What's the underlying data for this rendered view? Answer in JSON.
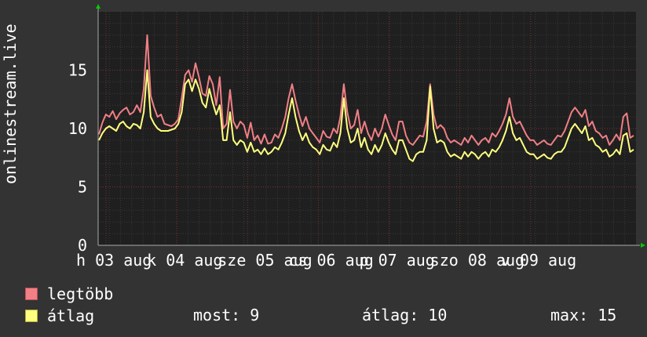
{
  "chart_data": {
    "type": "line",
    "ylabel": "onlinestream.live",
    "ylim": [
      0,
      20
    ],
    "yticks": [
      0,
      5,
      10,
      15
    ],
    "xtick_labels": [
      "h 03 aug",
      "k 04 aug",
      "sze 05 aug",
      "cs 06 aug",
      "p 07 aug",
      "szo 08 aug",
      "v 09 aug"
    ],
    "grid": true,
    "legend_position": "bottom-left",
    "series": [
      {
        "name": "legtöbb",
        "color": "#f07f86",
        "values": [
          9.5,
          10.5,
          11.2,
          11.0,
          11.5,
          10.8,
          11.3,
          11.6,
          11.8,
          11.2,
          11.4,
          12.0,
          11.4,
          13.4,
          18.0,
          12.8,
          11.8,
          11.0,
          11.2,
          10.4,
          10.3,
          10.2,
          10.4,
          10.8,
          12.6,
          14.6,
          15.0,
          14.0,
          15.6,
          14.4,
          13.0,
          12.8,
          14.5,
          13.8,
          12.0,
          14.4,
          10.0,
          10.4,
          13.3,
          10.6,
          10.0,
          10.6,
          10.3,
          9.2,
          10.5,
          9.0,
          9.4,
          8.7,
          9.5,
          8.7,
          8.8,
          9.5,
          9.2,
          10.0,
          11.0,
          12.6,
          13.8,
          12.4,
          11.2,
          10.2,
          11.0,
          10.0,
          9.6,
          9.2,
          8.8,
          9.8,
          9.3,
          9.2,
          10.0,
          9.6,
          11.0,
          13.8,
          11.4,
          10.0,
          10.3,
          11.6,
          9.6,
          10.6,
          9.6,
          9.0,
          10.0,
          9.3,
          10.0,
          11.2,
          10.3,
          9.5,
          9.0,
          10.6,
          10.6,
          9.4,
          8.8,
          8.6,
          9.0,
          9.4,
          9.3,
          10.6,
          13.8,
          11.2,
          10.0,
          10.3,
          10.0,
          9.2,
          8.8,
          9.0,
          8.8,
          8.6,
          9.2,
          8.8,
          9.4,
          9.0,
          8.6,
          9.0,
          9.2,
          8.8,
          9.6,
          9.3,
          9.8,
          10.4,
          11.2,
          12.6,
          11.0,
          10.4,
          10.6,
          10.0,
          9.4,
          9.0,
          9.0,
          8.6,
          8.8,
          9.0,
          8.7,
          8.6,
          9.0,
          9.4,
          9.3,
          9.8,
          10.6,
          11.4,
          11.8,
          11.4,
          11.0,
          11.6,
          10.2,
          10.6,
          9.8,
          9.6,
          9.2,
          9.4,
          8.6,
          9.0,
          9.5,
          9.0,
          11.0,
          11.3,
          9.2,
          9.4
        ]
      },
      {
        "name": "átlag",
        "color": "#ffff7f",
        "values": [
          9.0,
          9.6,
          10.0,
          10.2,
          10.0,
          9.8,
          10.4,
          10.6,
          10.2,
          10.0,
          10.4,
          10.3,
          10.0,
          11.4,
          15.0,
          11.0,
          10.4,
          10.0,
          9.8,
          9.8,
          9.8,
          9.9,
          10.0,
          10.4,
          11.4,
          13.8,
          14.2,
          13.2,
          14.2,
          13.4,
          12.2,
          11.8,
          13.4,
          12.2,
          11.2,
          12.0,
          9.0,
          9.0,
          11.4,
          9.0,
          8.6,
          9.0,
          8.8,
          8.0,
          8.8,
          8.0,
          8.2,
          7.8,
          8.3,
          7.8,
          8.0,
          8.4,
          8.2,
          8.8,
          9.6,
          11.2,
          12.6,
          11.0,
          9.8,
          9.0,
          9.6,
          8.8,
          8.4,
          8.2,
          7.8,
          8.6,
          8.2,
          8.1,
          8.8,
          8.4,
          9.6,
          12.6,
          10.0,
          8.8,
          9.0,
          10.0,
          8.4,
          9.2,
          8.2,
          7.8,
          8.6,
          8.0,
          8.6,
          9.6,
          8.8,
          8.2,
          7.8,
          9.0,
          9.0,
          8.2,
          7.4,
          7.2,
          7.8,
          8.0,
          8.0,
          9.0,
          13.6,
          10.0,
          8.8,
          9.0,
          8.8,
          8.0,
          7.6,
          7.8,
          7.6,
          7.4,
          8.0,
          7.6,
          8.0,
          7.8,
          7.4,
          7.8,
          8.0,
          7.6,
          8.2,
          8.0,
          8.4,
          9.0,
          9.8,
          11.0,
          9.6,
          9.0,
          9.2,
          8.6,
          8.0,
          7.8,
          7.8,
          7.4,
          7.6,
          7.8,
          7.5,
          7.4,
          7.8,
          8.0,
          8.0,
          8.4,
          9.2,
          10.0,
          10.4,
          10.0,
          9.6,
          10.2,
          9.0,
          9.2,
          8.6,
          8.4,
          8.0,
          8.2,
          7.6,
          7.8,
          8.2,
          7.8,
          9.4,
          9.6,
          8.0,
          8.2
        ]
      }
    ]
  },
  "legend": [
    {
      "label": "legtöbb",
      "color": "#f07f86"
    },
    {
      "label": "átlag",
      "color": "#ffff7f"
    }
  ],
  "stats": {
    "most": "most: 9",
    "atlag": "átlag: 10",
    "max": "max: 15"
  }
}
